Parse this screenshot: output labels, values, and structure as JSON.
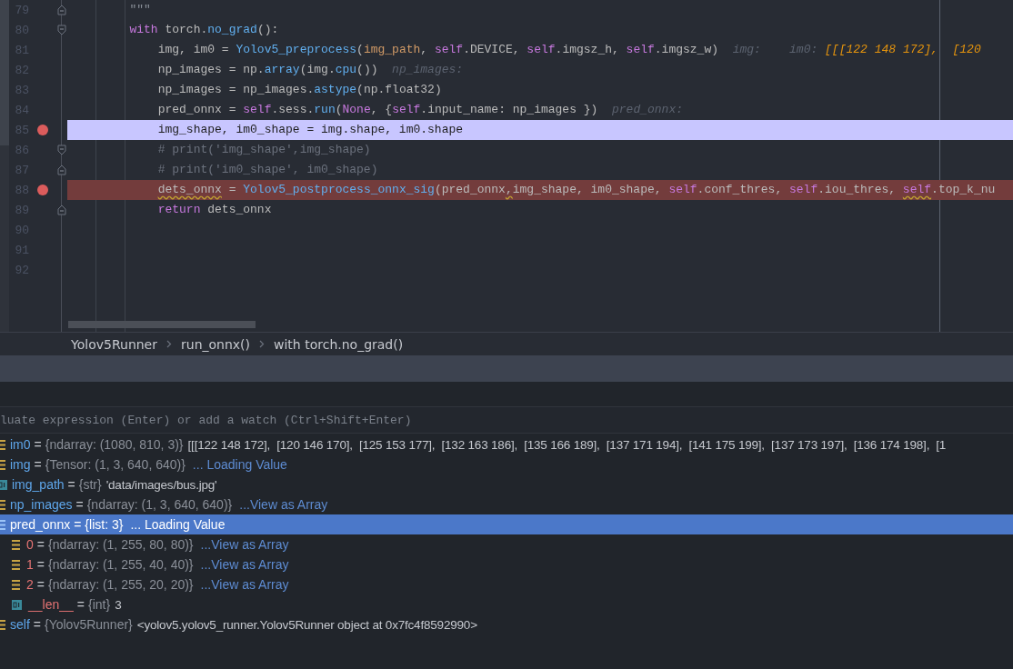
{
  "editor": {
    "lines": [
      {
        "number": "79",
        "fold_start": false,
        "fold_end": true,
        "current": false,
        "breakpoint": false,
        "tokens": [
          {
            "t": "        \"\"\"",
            "kind": "str"
          }
        ]
      },
      {
        "number": "80",
        "fold_start": true,
        "fold_end": false,
        "current": false,
        "breakpoint": false,
        "tokens": [
          {
            "t": "        with",
            "kind": "kw"
          },
          {
            "t": " torch.",
            "kind": "plain"
          },
          {
            "t": "no_grad",
            "kind": "fn"
          },
          {
            "t": "():",
            "kind": "plain"
          }
        ]
      },
      {
        "number": "81",
        "fold_start": false,
        "fold_end": false,
        "current": false,
        "breakpoint": false,
        "tokens": [
          {
            "t": "            img, im0 = ",
            "kind": "plain"
          },
          {
            "t": "Yolov5_preprocess",
            "kind": "fn"
          },
          {
            "t": "(",
            "kind": "plain"
          },
          {
            "t": "img_path",
            "kind": "param"
          },
          {
            "t": ", ",
            "kind": "plain"
          },
          {
            "t": "self",
            "kind": "self"
          },
          {
            "t": ".DEVICE, ",
            "kind": "plain"
          },
          {
            "t": "self",
            "kind": "self"
          },
          {
            "t": ".imgsz_h, ",
            "kind": "plain"
          },
          {
            "t": "self",
            "kind": "self"
          },
          {
            "t": ".imgsz_w)",
            "kind": "plain"
          },
          {
            "t": "img:",
            "kind": "hint"
          },
          {
            "t": "im0:",
            "kind": "hint-far"
          },
          {
            "t": "[[[122 148 172],  [120",
            "kind": "hintval"
          }
        ]
      },
      {
        "number": "82",
        "fold_start": false,
        "fold_end": false,
        "current": false,
        "breakpoint": false,
        "tokens": [
          {
            "t": "            np_images = np.",
            "kind": "plain"
          },
          {
            "t": "array",
            "kind": "fn"
          },
          {
            "t": "(img.",
            "kind": "plain"
          },
          {
            "t": "cpu",
            "kind": "fn"
          },
          {
            "t": "())",
            "kind": "plain"
          },
          {
            "t": "np_images:",
            "kind": "hint"
          }
        ]
      },
      {
        "number": "83",
        "fold_start": false,
        "fold_end": false,
        "current": false,
        "breakpoint": false,
        "tokens": [
          {
            "t": "            np_images = np_images.",
            "kind": "plain"
          },
          {
            "t": "astype",
            "kind": "fn"
          },
          {
            "t": "(np.float32)",
            "kind": "plain"
          }
        ]
      },
      {
        "number": "84",
        "fold_start": false,
        "fold_end": false,
        "current": false,
        "breakpoint": false,
        "tokens": [
          {
            "t": "            pred_onnx = ",
            "kind": "plain"
          },
          {
            "t": "self",
            "kind": "self"
          },
          {
            "t": ".sess.",
            "kind": "plain"
          },
          {
            "t": "run",
            "kind": "fn"
          },
          {
            "t": "(",
            "kind": "plain"
          },
          {
            "t": "None",
            "kind": "kw"
          },
          {
            "t": ", {",
            "kind": "plain"
          },
          {
            "t": "self",
            "kind": "self"
          },
          {
            "t": ".input_name: np_images })",
            "kind": "plain"
          },
          {
            "t": "pred_onnx:",
            "kind": "hint"
          }
        ]
      },
      {
        "number": "85",
        "fold_start": false,
        "fold_end": false,
        "current": true,
        "breakpoint": true,
        "tokens": [
          {
            "t": "            img_shape, im0_shape = img.shape, im0.shape",
            "kind": "plain"
          }
        ]
      },
      {
        "number": "86",
        "fold_start": true,
        "fold_end": false,
        "current": false,
        "breakpoint": false,
        "tokens": [
          {
            "t": "            # print('img_shape',img_shape)",
            "kind": "cmt"
          }
        ]
      },
      {
        "number": "87",
        "fold_start": false,
        "fold_end": true,
        "current": false,
        "breakpoint": false,
        "tokens": [
          {
            "t": "            # print('im0_shape', im0_shape)",
            "kind": "cmt"
          }
        ]
      },
      {
        "number": "88",
        "fold_start": false,
        "fold_end": false,
        "current": false,
        "breakpoint": true,
        "tokens": [
          {
            "t": "            dets_onnx",
            "kind": "warn"
          },
          {
            "t": " = ",
            "kind": "plain"
          },
          {
            "t": "Yolov5_postprocess_onnx_sig",
            "kind": "fn"
          },
          {
            "t": "(pred_onnx",
            "kind": "plain"
          },
          {
            "t": ",",
            "kind": "warn"
          },
          {
            "t": "img_shape, im0_shape, ",
            "kind": "plain"
          },
          {
            "t": "self",
            "kind": "self"
          },
          {
            "t": ".conf_thres, ",
            "kind": "plain"
          },
          {
            "t": "self",
            "kind": "self"
          },
          {
            "t": ".iou_thres, ",
            "kind": "plain"
          },
          {
            "t": "self",
            "kind": "self-warn"
          },
          {
            "t": ".top_k_nu",
            "kind": "plain"
          }
        ]
      },
      {
        "number": "89",
        "fold_start": false,
        "fold_end": true,
        "current": false,
        "breakpoint": false,
        "tokens": [
          {
            "t": "            return",
            "kind": "kw"
          },
          {
            "t": " dets_onnx",
            "kind": "plain"
          }
        ]
      },
      {
        "number": "90",
        "fold_start": false,
        "fold_end": false,
        "current": false,
        "breakpoint": false
      },
      {
        "number": "91",
        "fold_start": false,
        "fold_end": false,
        "current": false,
        "breakpoint": false
      },
      {
        "number": "92",
        "fold_start": false,
        "fold_end": false,
        "current": false,
        "breakpoint": false
      }
    ]
  },
  "breadcrumbs": [
    "Yolov5Runner",
    "run_onnx()",
    "with torch.no_grad()"
  ],
  "evaluate": {
    "placeholder": "luate expression (Enter) or add a watch (Ctrl+Shift+Enter)"
  },
  "variables": [
    {
      "kind": "array",
      "name": "im0",
      "sep": "=",
      "type": "{ndarray: (1080, 810, 3)}",
      "value": "[[[122 148 172],  [120 146 170],  [125 153 177],  [132 163 186],  [135 166 189],  [137 171 194],  [141 175 199],  [137 173 197],  [136 174 198],  [1",
      "link": false,
      "selected": false
    },
    {
      "kind": "array",
      "name": "img",
      "sep": "=",
      "type": "{Tensor: (1, 3, 640, 640)}",
      "value": "... Loading Value",
      "link": true,
      "selected": false
    },
    {
      "kind": "scalar",
      "name": "img_path",
      "sep": "=",
      "type": "{str}",
      "value": "'data/images/bus.jpg'",
      "link": false,
      "selected": false
    },
    {
      "kind": "array",
      "name": "np_images",
      "sep": "=",
      "type": "{ndarray: (1, 3, 640, 640)}",
      "value": "...View as Array",
      "link": true,
      "selected": false
    },
    {
      "kind": "array",
      "name": "pred_onnx",
      "sep": "=",
      "type": "{list: 3}",
      "value": "... Loading Value",
      "link": true,
      "selected": true,
      "children": [
        {
          "kind": "array",
          "name": "0",
          "sep": "=",
          "type": "{ndarray: (1, 255, 80, 80)}",
          "value": "...View as Array",
          "link": true,
          "selected": false
        },
        {
          "kind": "array",
          "name": "1",
          "sep": "=",
          "type": "{ndarray: (1, 255, 40, 40)}",
          "value": "...View as Array",
          "link": true,
          "selected": false
        },
        {
          "kind": "array",
          "name": "2",
          "sep": "=",
          "type": "{ndarray: (1, 255, 20, 20)}",
          "value": "...View as Array",
          "link": true,
          "selected": false
        },
        {
          "kind": "scalar",
          "name": "__len__",
          "sep": "=",
          "type": "{int}",
          "value": "3",
          "link": false,
          "selected": false
        }
      ]
    },
    {
      "kind": "array",
      "name": "self",
      "sep": "=",
      "type": "{Yolov5Runner}",
      "value": "<yolov5.yolov5_runner.Yolov5Runner object at 0x7fc4f8592990>",
      "link": false,
      "selected": false
    }
  ]
}
